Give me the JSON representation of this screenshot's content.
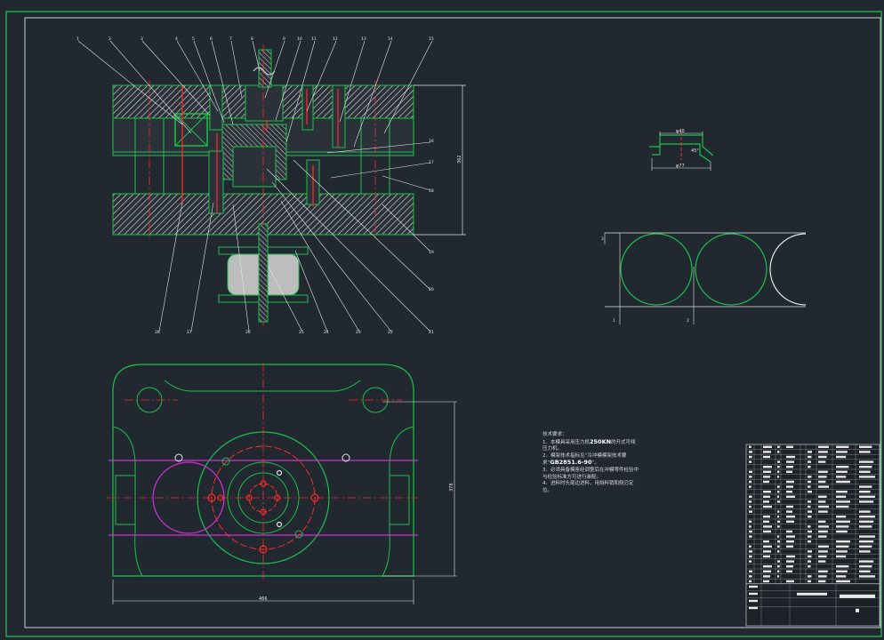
{
  "balloons_top": [
    "1",
    "2",
    "3",
    "4",
    "5",
    "6",
    "7",
    "8",
    "9",
    "10",
    "11",
    "12",
    "13",
    "14",
    "15"
  ],
  "balloons_right": [
    "16",
    "17",
    "18",
    "19",
    "20",
    "21"
  ],
  "balloons_bottom": [
    "28",
    "27",
    "26",
    "25",
    "24",
    "23",
    "22"
  ],
  "dims": {
    "section_height": "362",
    "plan_width": "466",
    "plan_height": "378",
    "part_top": "φ40",
    "part_bottom": "φ77",
    "part_angle": "45°"
  },
  "strip_labels": [
    "1",
    "2",
    "3"
  ],
  "tech_notes": {
    "title": "技术要求：",
    "l1a": "1．本模具采用压力机",
    "l1b": "250KN",
    "l1c": "的开式可倾压力机。",
    "l2a": "2．模架技术指标见“冷冲模模架技术要求”",
    "l2b": "GB2851.6-90",
    "l2c": "”。",
    "l3": "3．必须具备模座经调整后在冲模零件检验中与检验标准方可进行装配。",
    "l4": "4．进料时头尾边进料，用挡料销和侧刃定位。"
  },
  "colors": {
    "frame": "#22a84a",
    "outline": "#19c24a",
    "centerline": "#ff2a2a",
    "magenta": "#d42ed4",
    "white": "#e8e8e8"
  }
}
